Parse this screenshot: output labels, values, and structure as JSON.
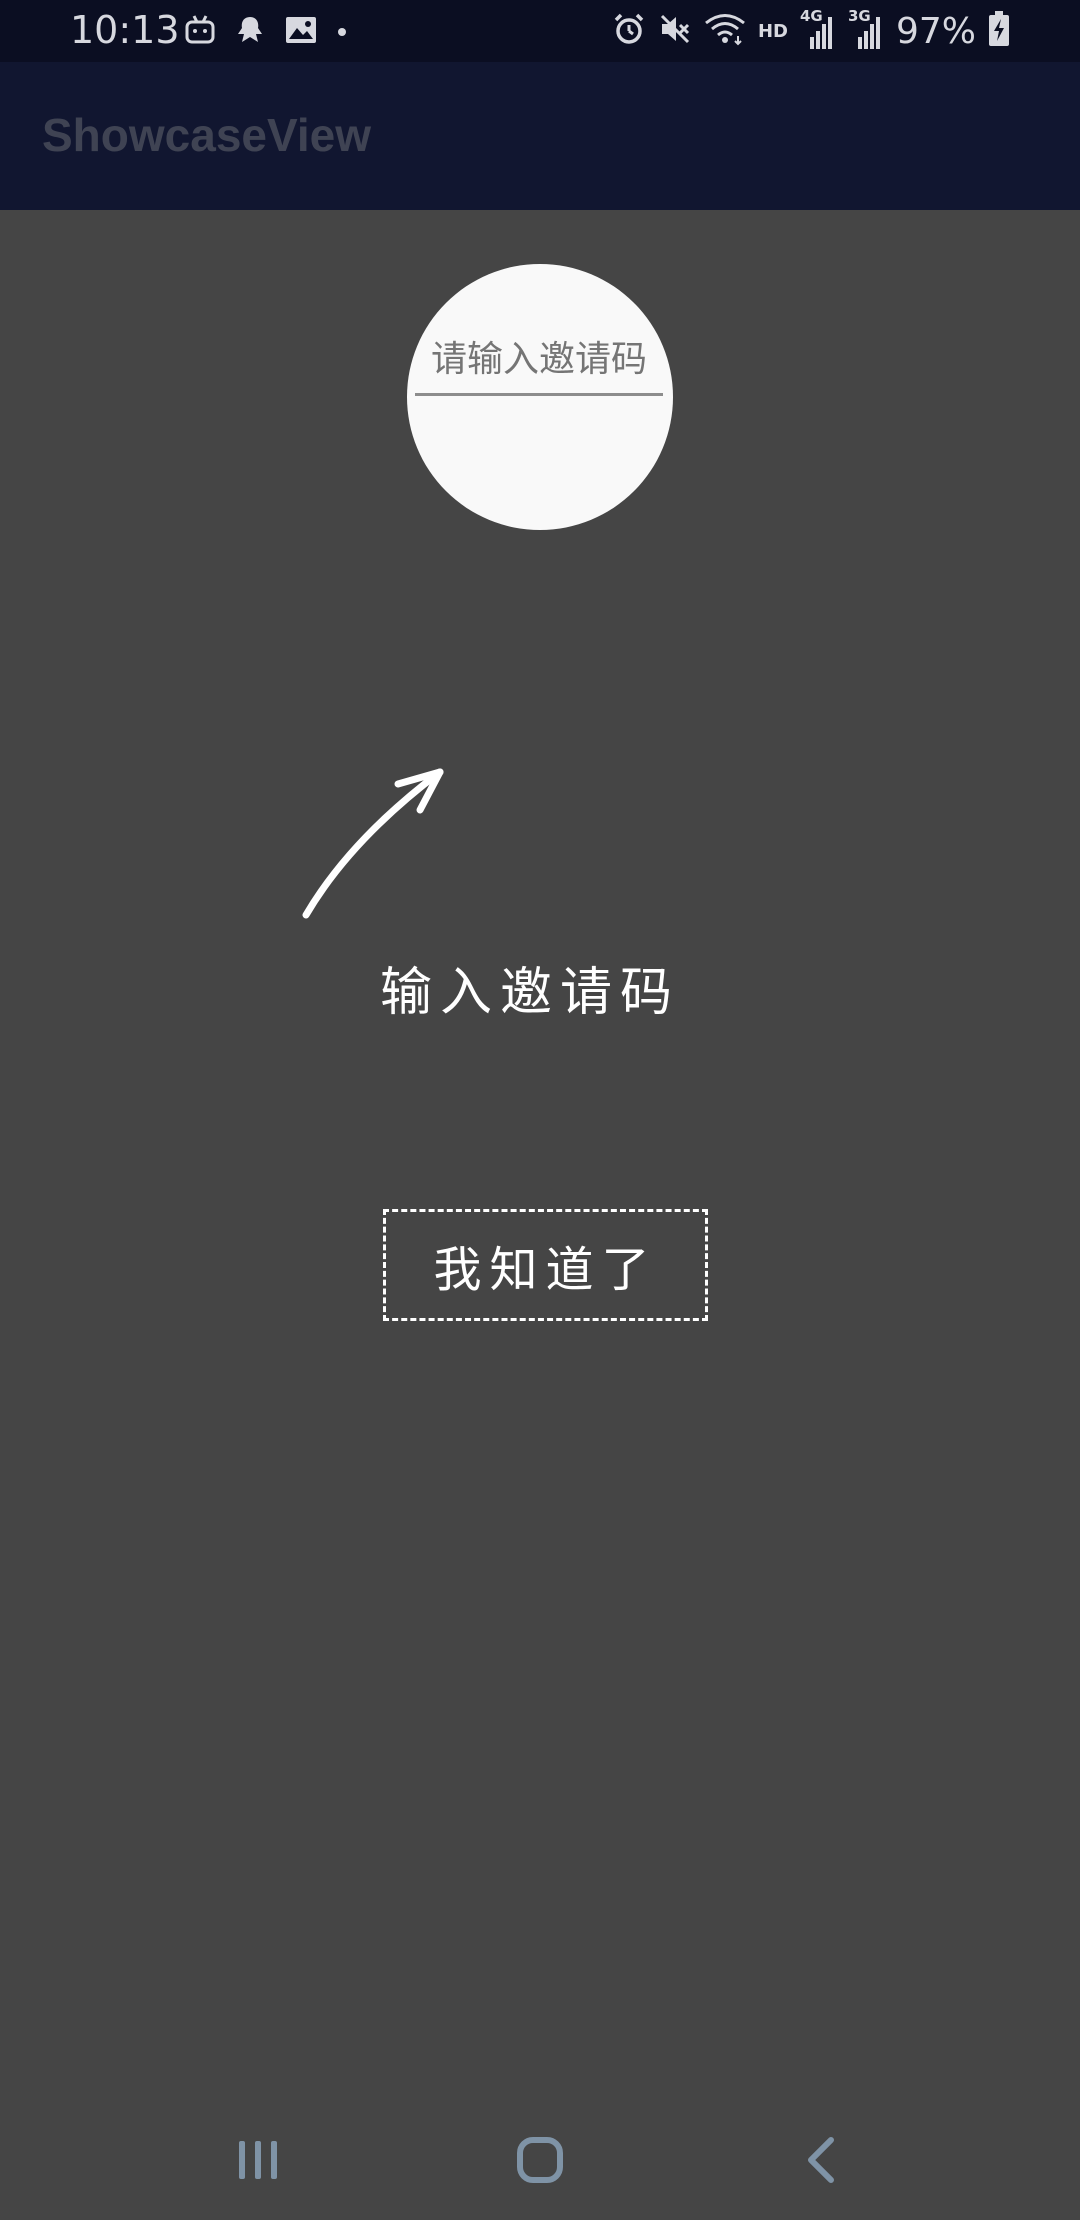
{
  "status_bar": {
    "time": "10:13",
    "network_hd": "HD",
    "network_4g": "4G",
    "network_3g": "3G",
    "battery_percent": "97%",
    "left_icons": [
      "bilibili-icon",
      "ghost-icon",
      "image-icon",
      "dot-icon"
    ],
    "right_icons": [
      "alarm-icon",
      "mute-icon",
      "wifi-icon",
      "signal-icon",
      "signal-icon",
      "battery-charging-icon"
    ]
  },
  "app_bar": {
    "title": "ShowcaseView"
  },
  "showcase": {
    "input_placeholder": "请输入邀请码",
    "hint": "输入邀请码",
    "dismiss_button": "我知道了"
  },
  "nav_bar": {
    "icons": [
      "recent-apps-icon",
      "home-icon",
      "back-icon"
    ]
  },
  "colors": {
    "status_bar_bg": "#0b0e22",
    "app_bar_bg": "#111630",
    "overlay_bg": "#454545",
    "spotlight": "#f9f9f9",
    "nav_icon": "#7f93a6"
  }
}
